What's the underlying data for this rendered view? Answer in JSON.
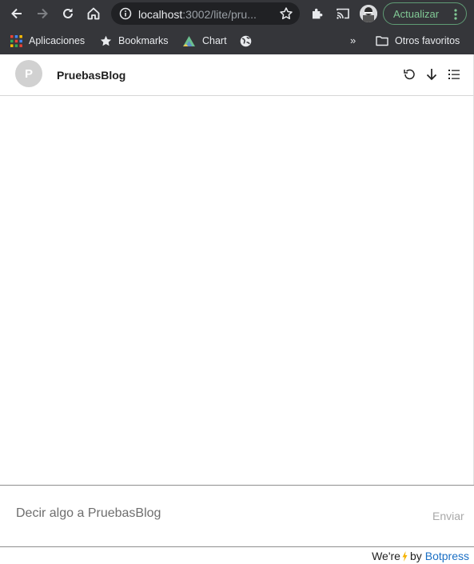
{
  "browser": {
    "url_host": "localhost",
    "url_path": ":3002/lite/pru...",
    "update_label": "Actualizar",
    "colors": {
      "update_accent": "#81c995",
      "chrome_bg": "#35363a",
      "omnibox_bg": "#202124"
    }
  },
  "bookmarks": {
    "items": [
      {
        "label": "Aplicaciones",
        "icon": "apps-grid-icon"
      },
      {
        "label": "Bookmarks",
        "icon": "star-icon"
      },
      {
        "label": "Chart",
        "icon": "chart-logo-icon"
      },
      {
        "label": "",
        "icon": "globe-icon"
      }
    ],
    "more": "»",
    "other_folder": "Otros favoritos"
  },
  "chat": {
    "avatar_initial": "P",
    "bot_name": "PruebasBlog",
    "header_icons": [
      "reset-conversation-icon",
      "download-transcript-icon",
      "conversations-list-icon"
    ],
    "composer_placeholder": "Decir algo a PruebasBlog",
    "send_label": "Enviar",
    "footer": {
      "prefix": "We're",
      "by": "by",
      "brand": "Botpress",
      "brand_color": "#1a6fc4",
      "bolt_color": "#f5b301"
    }
  }
}
